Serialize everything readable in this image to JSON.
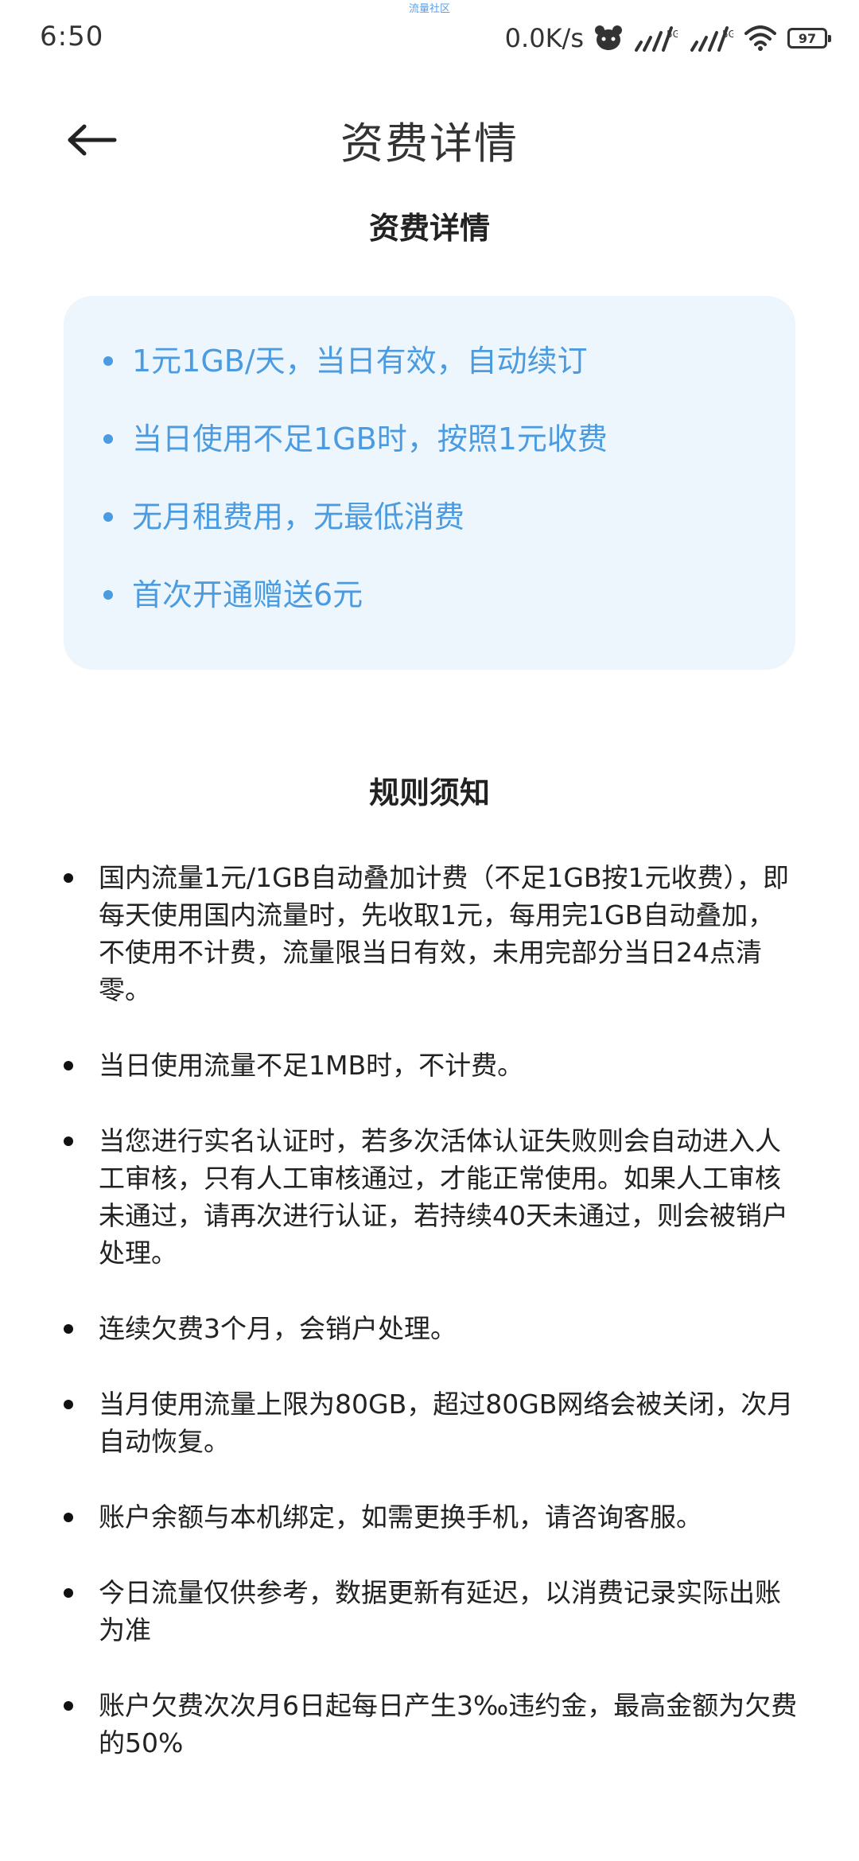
{
  "status_bar": {
    "time": "6:50",
    "center_label": "流量社区",
    "net_speed": "0.0K/s",
    "battery_level": "97"
  },
  "header": {
    "title": "资费详情",
    "back_icon": "arrow-left-icon"
  },
  "fee_section": {
    "title": "资费详情",
    "items": [
      "1元1GB/天，当日有效，自动续订",
      "当日使用不足1GB时，按照1元收费",
      "无月租费用，无最低消费",
      "首次开通赠送6元"
    ]
  },
  "rules_section": {
    "title": "规则须知",
    "items": [
      "国内流量1元/1GB自动叠加计费（不足1GB按1元收费），即每天使用国内流量时，先收取1元，每用完1GB自动叠加，不使用不计费，流量限当日有效，未用完部分当日24点清零。",
      "当日使用流量不足1MB时，不计费。",
      "当您进行实名认证时，若多次活体认证失败则会自动进入人工审核，只有人工审核通过，才能正常使用。如果人工审核未通过，请再次进行认证，若持续40天未通过，则会被销户处理。",
      "连续欠费3个月，会销户处理。",
      "当月使用流量上限为80GB，超过80GB网络会被关闭，次月自动恢复。",
      "账户余额与本机绑定，如需更换手机，请咨询客服。",
      "今日流量仅供参考，数据更新有延迟，以消费记录实际出账为准",
      "账户欠费次次月6日起每日产生3‰违约金，最高金额为欠费的50%"
    ]
  },
  "colors": {
    "card_background": "#eef6fd",
    "accent_blue": "#4a9be0",
    "text_primary": "#222222"
  }
}
